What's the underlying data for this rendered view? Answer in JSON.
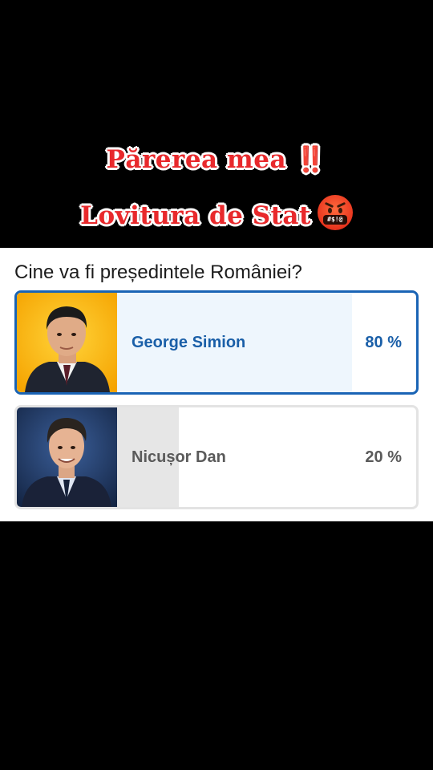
{
  "caption": {
    "line1": "Părerea mea ‼️",
    "line2": "Lovitura de Stat",
    "emoji_text": "#$!@"
  },
  "poll": {
    "question": "Cine va fi președintele României?",
    "options": [
      {
        "name": "George Simion",
        "percent_label": "80 %",
        "percent": 80,
        "selected": true,
        "photo": "portrait-george-simion"
      },
      {
        "name": "Nicușor Dan",
        "percent_label": "20 %",
        "percent": 20,
        "selected": false,
        "photo": "portrait-nicusor-dan"
      }
    ]
  },
  "colors": {
    "caption_red": "#e8292c",
    "selected_border": "#1a64b5",
    "selected_text": "#1a5fa8",
    "selected_fill": "#eef6fd",
    "unselected_border": "#e3e3e3",
    "unselected_fill": "#e6e6e6",
    "unselected_text": "#5a5a5a"
  }
}
